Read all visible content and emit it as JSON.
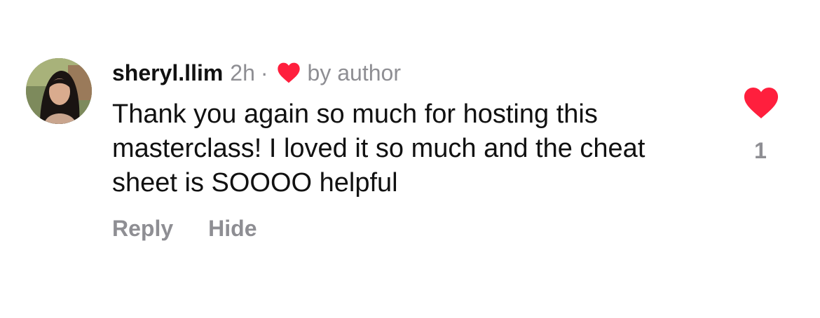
{
  "comment": {
    "username": "sheryl.llim",
    "timestamp": "2h",
    "separator": "·",
    "liked_by_author_label": "by author",
    "text": "Thank you again so much for hosting this masterclass! I loved it so much and the cheat sheet is SOOOO helpful",
    "actions": {
      "reply_label": "Reply",
      "hide_label": "Hide"
    },
    "like": {
      "count": "1",
      "icon": "heart-filled-icon",
      "liked": true
    },
    "author_like_icon": "heart-filled-icon"
  },
  "colors": {
    "heart": "#ff1f3d",
    "muted_text": "#8e8e93",
    "primary_text": "#111111",
    "background": "#ffffff"
  }
}
